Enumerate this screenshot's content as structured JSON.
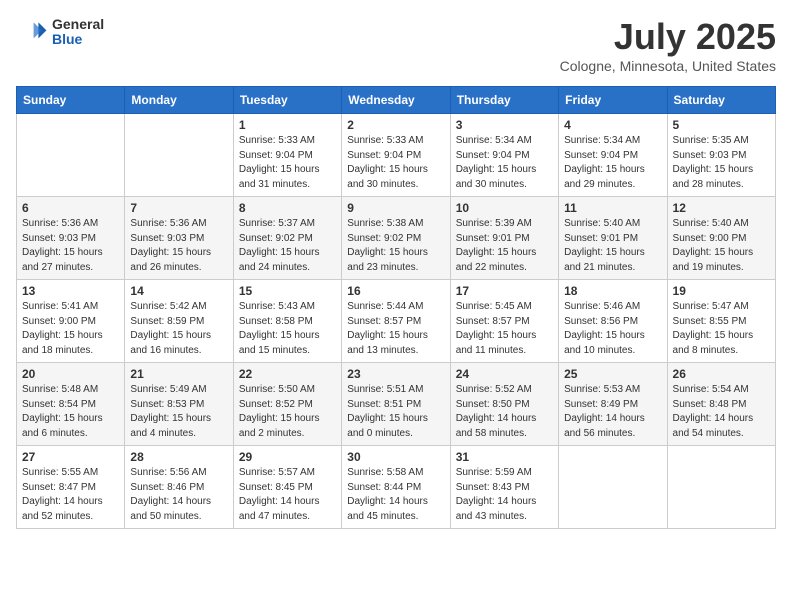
{
  "header": {
    "logo_general": "General",
    "logo_blue": "Blue",
    "title": "July 2025",
    "subtitle": "Cologne, Minnesota, United States"
  },
  "weekdays": [
    "Sunday",
    "Monday",
    "Tuesday",
    "Wednesday",
    "Thursday",
    "Friday",
    "Saturday"
  ],
  "weeks": [
    [
      {
        "day": "",
        "sunrise": "",
        "sunset": "",
        "daylight": ""
      },
      {
        "day": "",
        "sunrise": "",
        "sunset": "",
        "daylight": ""
      },
      {
        "day": "1",
        "sunrise": "Sunrise: 5:33 AM",
        "sunset": "Sunset: 9:04 PM",
        "daylight": "Daylight: 15 hours and 31 minutes."
      },
      {
        "day": "2",
        "sunrise": "Sunrise: 5:33 AM",
        "sunset": "Sunset: 9:04 PM",
        "daylight": "Daylight: 15 hours and 30 minutes."
      },
      {
        "day": "3",
        "sunrise": "Sunrise: 5:34 AM",
        "sunset": "Sunset: 9:04 PM",
        "daylight": "Daylight: 15 hours and 30 minutes."
      },
      {
        "day": "4",
        "sunrise": "Sunrise: 5:34 AM",
        "sunset": "Sunset: 9:04 PM",
        "daylight": "Daylight: 15 hours and 29 minutes."
      },
      {
        "day": "5",
        "sunrise": "Sunrise: 5:35 AM",
        "sunset": "Sunset: 9:03 PM",
        "daylight": "Daylight: 15 hours and 28 minutes."
      }
    ],
    [
      {
        "day": "6",
        "sunrise": "Sunrise: 5:36 AM",
        "sunset": "Sunset: 9:03 PM",
        "daylight": "Daylight: 15 hours and 27 minutes."
      },
      {
        "day": "7",
        "sunrise": "Sunrise: 5:36 AM",
        "sunset": "Sunset: 9:03 PM",
        "daylight": "Daylight: 15 hours and 26 minutes."
      },
      {
        "day": "8",
        "sunrise": "Sunrise: 5:37 AM",
        "sunset": "Sunset: 9:02 PM",
        "daylight": "Daylight: 15 hours and 24 minutes."
      },
      {
        "day": "9",
        "sunrise": "Sunrise: 5:38 AM",
        "sunset": "Sunset: 9:02 PM",
        "daylight": "Daylight: 15 hours and 23 minutes."
      },
      {
        "day": "10",
        "sunrise": "Sunrise: 5:39 AM",
        "sunset": "Sunset: 9:01 PM",
        "daylight": "Daylight: 15 hours and 22 minutes."
      },
      {
        "day": "11",
        "sunrise": "Sunrise: 5:40 AM",
        "sunset": "Sunset: 9:01 PM",
        "daylight": "Daylight: 15 hours and 21 minutes."
      },
      {
        "day": "12",
        "sunrise": "Sunrise: 5:40 AM",
        "sunset": "Sunset: 9:00 PM",
        "daylight": "Daylight: 15 hours and 19 minutes."
      }
    ],
    [
      {
        "day": "13",
        "sunrise": "Sunrise: 5:41 AM",
        "sunset": "Sunset: 9:00 PM",
        "daylight": "Daylight: 15 hours and 18 minutes."
      },
      {
        "day": "14",
        "sunrise": "Sunrise: 5:42 AM",
        "sunset": "Sunset: 8:59 PM",
        "daylight": "Daylight: 15 hours and 16 minutes."
      },
      {
        "day": "15",
        "sunrise": "Sunrise: 5:43 AM",
        "sunset": "Sunset: 8:58 PM",
        "daylight": "Daylight: 15 hours and 15 minutes."
      },
      {
        "day": "16",
        "sunrise": "Sunrise: 5:44 AM",
        "sunset": "Sunset: 8:57 PM",
        "daylight": "Daylight: 15 hours and 13 minutes."
      },
      {
        "day": "17",
        "sunrise": "Sunrise: 5:45 AM",
        "sunset": "Sunset: 8:57 PM",
        "daylight": "Daylight: 15 hours and 11 minutes."
      },
      {
        "day": "18",
        "sunrise": "Sunrise: 5:46 AM",
        "sunset": "Sunset: 8:56 PM",
        "daylight": "Daylight: 15 hours and 10 minutes."
      },
      {
        "day": "19",
        "sunrise": "Sunrise: 5:47 AM",
        "sunset": "Sunset: 8:55 PM",
        "daylight": "Daylight: 15 hours and 8 minutes."
      }
    ],
    [
      {
        "day": "20",
        "sunrise": "Sunrise: 5:48 AM",
        "sunset": "Sunset: 8:54 PM",
        "daylight": "Daylight: 15 hours and 6 minutes."
      },
      {
        "day": "21",
        "sunrise": "Sunrise: 5:49 AM",
        "sunset": "Sunset: 8:53 PM",
        "daylight": "Daylight: 15 hours and 4 minutes."
      },
      {
        "day": "22",
        "sunrise": "Sunrise: 5:50 AM",
        "sunset": "Sunset: 8:52 PM",
        "daylight": "Daylight: 15 hours and 2 minutes."
      },
      {
        "day": "23",
        "sunrise": "Sunrise: 5:51 AM",
        "sunset": "Sunset: 8:51 PM",
        "daylight": "Daylight: 15 hours and 0 minutes."
      },
      {
        "day": "24",
        "sunrise": "Sunrise: 5:52 AM",
        "sunset": "Sunset: 8:50 PM",
        "daylight": "Daylight: 14 hours and 58 minutes."
      },
      {
        "day": "25",
        "sunrise": "Sunrise: 5:53 AM",
        "sunset": "Sunset: 8:49 PM",
        "daylight": "Daylight: 14 hours and 56 minutes."
      },
      {
        "day": "26",
        "sunrise": "Sunrise: 5:54 AM",
        "sunset": "Sunset: 8:48 PM",
        "daylight": "Daylight: 14 hours and 54 minutes."
      }
    ],
    [
      {
        "day": "27",
        "sunrise": "Sunrise: 5:55 AM",
        "sunset": "Sunset: 8:47 PM",
        "daylight": "Daylight: 14 hours and 52 minutes."
      },
      {
        "day": "28",
        "sunrise": "Sunrise: 5:56 AM",
        "sunset": "Sunset: 8:46 PM",
        "daylight": "Daylight: 14 hours and 50 minutes."
      },
      {
        "day": "29",
        "sunrise": "Sunrise: 5:57 AM",
        "sunset": "Sunset: 8:45 PM",
        "daylight": "Daylight: 14 hours and 47 minutes."
      },
      {
        "day": "30",
        "sunrise": "Sunrise: 5:58 AM",
        "sunset": "Sunset: 8:44 PM",
        "daylight": "Daylight: 14 hours and 45 minutes."
      },
      {
        "day": "31",
        "sunrise": "Sunrise: 5:59 AM",
        "sunset": "Sunset: 8:43 PM",
        "daylight": "Daylight: 14 hours and 43 minutes."
      },
      {
        "day": "",
        "sunrise": "",
        "sunset": "",
        "daylight": ""
      },
      {
        "day": "",
        "sunrise": "",
        "sunset": "",
        "daylight": ""
      }
    ]
  ]
}
